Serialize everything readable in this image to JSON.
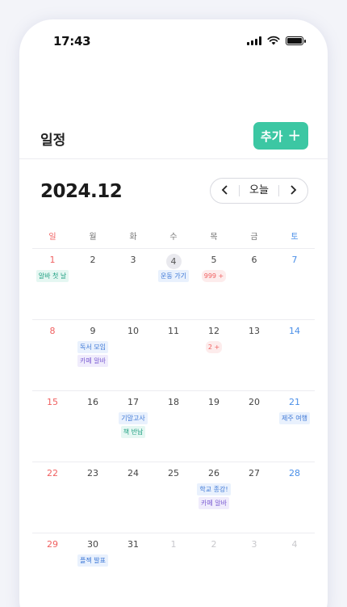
{
  "status": {
    "time": "17:43"
  },
  "header": {
    "title": "일정",
    "add_label": "추가"
  },
  "calendar": {
    "month": "2024.12",
    "today_label": "오늘",
    "weekdays": [
      "일",
      "월",
      "화",
      "수",
      "목",
      "금",
      "토"
    ],
    "weeks": [
      {
        "days": [
          {
            "num": "1",
            "events": [
              {
                "text": "알바 첫 날",
                "color": "green"
              }
            ]
          },
          {
            "num": "2",
            "events": []
          },
          {
            "num": "3",
            "events": []
          },
          {
            "num": "4",
            "today": true,
            "events": [
              {
                "text": "운동 가기",
                "color": "blue"
              }
            ]
          },
          {
            "num": "5",
            "events": [
              {
                "text": "999 +",
                "color": "red"
              }
            ]
          },
          {
            "num": "6",
            "events": []
          },
          {
            "num": "7",
            "events": []
          }
        ]
      },
      {
        "days": [
          {
            "num": "8",
            "events": []
          },
          {
            "num": "9",
            "events": [
              {
                "text": "독서 모임",
                "color": "blue"
              },
              {
                "text": "카페 알바",
                "color": "purple"
              }
            ]
          },
          {
            "num": "10",
            "events": []
          },
          {
            "num": "11",
            "events": []
          },
          {
            "num": "12",
            "events": [
              {
                "text": "2 +",
                "color": "red"
              }
            ]
          },
          {
            "num": "13",
            "events": []
          },
          {
            "num": "14",
            "events": []
          }
        ]
      },
      {
        "days": [
          {
            "num": "15",
            "events": []
          },
          {
            "num": "16",
            "events": []
          },
          {
            "num": "17",
            "events": [
              {
                "text": "기말고사",
                "color": "blue"
              },
              {
                "text": "책 반납",
                "color": "green"
              }
            ]
          },
          {
            "num": "18",
            "events": []
          },
          {
            "num": "19",
            "events": []
          },
          {
            "num": "20",
            "events": []
          },
          {
            "num": "21",
            "events": [
              {
                "text": "제주 여행",
                "color": "blue"
              }
            ]
          }
        ]
      },
      {
        "days": [
          {
            "num": "22",
            "events": []
          },
          {
            "num": "23",
            "events": []
          },
          {
            "num": "24",
            "events": []
          },
          {
            "num": "25",
            "events": []
          },
          {
            "num": "26",
            "events": [
              {
                "text": "학교 종강!",
                "color": "blue"
              },
              {
                "text": "카페 알바",
                "color": "purple"
              }
            ]
          },
          {
            "num": "27",
            "events": []
          },
          {
            "num": "28",
            "events": []
          }
        ]
      },
      {
        "days": [
          {
            "num": "29",
            "events": []
          },
          {
            "num": "30",
            "events": [
              {
                "text": "플젝 발표",
                "color": "blue"
              }
            ]
          },
          {
            "num": "31",
            "events": []
          },
          {
            "num": "1",
            "other": true,
            "events": []
          },
          {
            "num": "2",
            "other": true,
            "events": []
          },
          {
            "num": "3",
            "other": true,
            "events": []
          },
          {
            "num": "4",
            "other": true,
            "events": []
          }
        ]
      }
    ]
  },
  "colors": {
    "accent": "#3cc7a3",
    "sunday": "#f06060",
    "saturday": "#4a8fe8"
  }
}
